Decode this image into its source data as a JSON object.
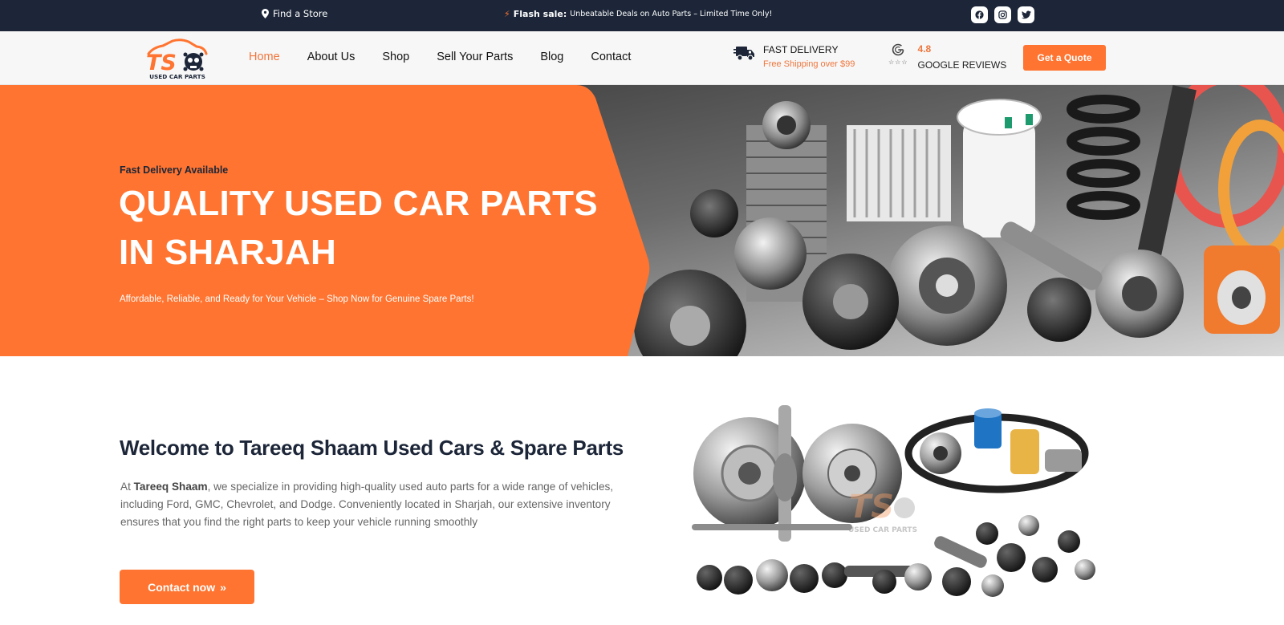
{
  "topbar": {
    "store_label": "Find a Store",
    "flash_label": "Flash sale:",
    "flash_text": "Unbeatable Deals on Auto Parts – Limited Time Only!",
    "social": [
      "facebook-icon",
      "instagram-icon",
      "twitter-icon"
    ]
  },
  "header": {
    "logo_letters": "TS",
    "logo_caption": "USED CAR PARTS",
    "nav": [
      "Home",
      "About Us",
      "Shop",
      "Sell Your Parts",
      "Blog",
      "Contact"
    ],
    "active_nav": "Home",
    "delivery_title": "FAST DELIVERY",
    "delivery_sub": "Free Shipping over $99",
    "rating": "4.8",
    "reviews_label": "GOOGLE REVIEWS",
    "quote_button": "Get a Quote"
  },
  "hero": {
    "kicker": "Fast Delivery Available",
    "title": "QUALITY USED CAR PARTS IN SHARJAH",
    "subtitle": "Affordable, Reliable, and Ready for Your Vehicle – Shop Now for Genuine Spare Parts!"
  },
  "about": {
    "title": "Welcome to Tareeq Shaam Used Cars & Spare Parts",
    "text_prefix": "At ",
    "company": "Tareeq Shaam",
    "text_body": ", we specialize in providing high-quality used auto parts for a wide range of vehicles, including Ford, GMC, Chevrolet, and Dodge. Conveniently located in Sharjah, our extensive inventory ensures that you find the right parts to keep your vehicle running smoothly",
    "button": "Contact now"
  },
  "colors": {
    "accent": "#ff7430",
    "navy": "#1c2638",
    "text_gray": "#666666"
  }
}
